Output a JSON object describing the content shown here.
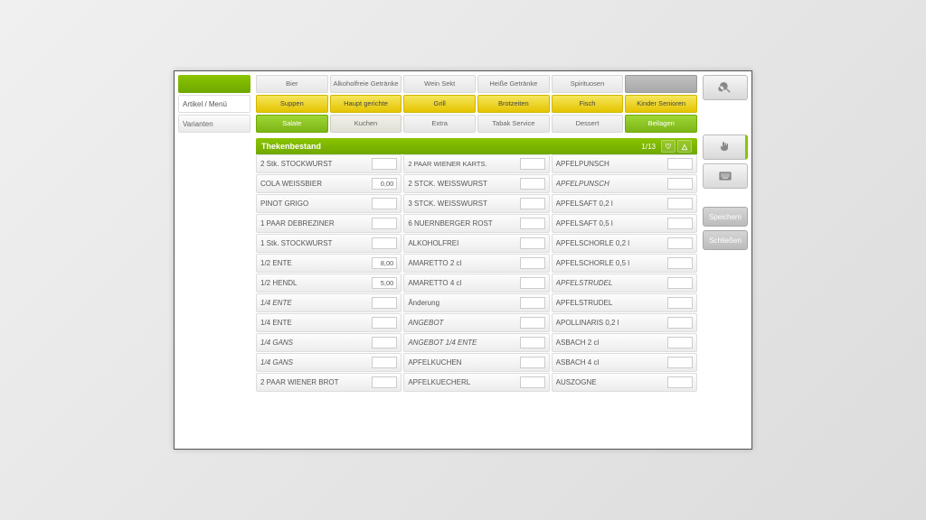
{
  "sidebar": {
    "items": [
      {
        "label": "Artikel / Menü"
      },
      {
        "label": "Varianten"
      }
    ]
  },
  "tabs": {
    "row1": [
      {
        "label": "Bier",
        "style": "gray"
      },
      {
        "label": "Alkoholfreie Getränke",
        "style": "gray"
      },
      {
        "label": "Wein Sekt",
        "style": "gray"
      },
      {
        "label": "Heiße Getränke",
        "style": "gray"
      },
      {
        "label": "Spirituosen",
        "style": "gray"
      },
      {
        "label": "",
        "style": "darkgray"
      }
    ],
    "row2": [
      {
        "label": "Suppen",
        "style": "yellow"
      },
      {
        "label": "Haupt gerichte",
        "style": "yellow"
      },
      {
        "label": "Grill",
        "style": "yellow"
      },
      {
        "label": "Brotzeiten",
        "style": "yellow"
      },
      {
        "label": "Fisch",
        "style": "yellow"
      },
      {
        "label": "Kinder Senioren",
        "style": "yellow"
      }
    ],
    "row3": [
      {
        "label": "Salate",
        "style": "green"
      },
      {
        "label": "Kuchen",
        "style": "lightgray-special"
      },
      {
        "label": "Extra",
        "style": "gray"
      },
      {
        "label": "Tabak Service",
        "style": "gray"
      },
      {
        "label": "Dessert",
        "style": "gray"
      },
      {
        "label": "Beilagen",
        "style": "green"
      }
    ]
  },
  "list": {
    "title": "Thekenbestand",
    "page": "1/13",
    "columns": [
      [
        {
          "label": "2 Stk. STOCKWURST",
          "qty": ""
        },
        {
          "label": "COLA WEISSBIER",
          "qty": "0,00"
        },
        {
          "label": "PINOT GRIGO",
          "qty": ""
        },
        {
          "label": "1 PAAR DEBREZINER",
          "qty": ""
        },
        {
          "label": "1 Stk. STOCKWURST",
          "qty": ""
        },
        {
          "label": "1/2 ENTE",
          "qty": "8,00"
        },
        {
          "label": "1/2 HENDL",
          "qty": "5,00"
        },
        {
          "label": "1/4 ENTE",
          "qty": "",
          "italic": true
        },
        {
          "label": "1/4 ENTE",
          "qty": ""
        },
        {
          "label": "1/4 GANS",
          "qty": "",
          "italic": true
        },
        {
          "label": "1/4 GANS",
          "qty": "",
          "italic": true
        },
        {
          "label": "2 PAAR WIENER BROT",
          "qty": ""
        }
      ],
      [
        {
          "label": "2 PAAR WIENER KARTS.",
          "qty": "",
          "twoline": true
        },
        {
          "label": "2 STCK. WEISSWURST",
          "qty": ""
        },
        {
          "label": "3 STCK. WEISSWURST",
          "qty": ""
        },
        {
          "label": "6 NUERNBERGER ROST",
          "qty": ""
        },
        {
          "label": "ALKOHOLFREI",
          "qty": ""
        },
        {
          "label": "AMARETTO 2 cl",
          "qty": ""
        },
        {
          "label": "AMARETTO 4 cl",
          "qty": ""
        },
        {
          "label": "Änderung",
          "qty": ""
        },
        {
          "label": "ANGEBOT",
          "qty": "",
          "italic": true
        },
        {
          "label": "ANGEBOT 1/4 ENTE",
          "qty": "",
          "italic": true
        },
        {
          "label": "APFELKUCHEN",
          "qty": ""
        },
        {
          "label": "APFELKUECHERL",
          "qty": ""
        }
      ],
      [
        {
          "label": "APFELPUNSCH",
          "qty": ""
        },
        {
          "label": "APFELPUNSCH",
          "qty": "",
          "italic": true
        },
        {
          "label": "APFELSAFT 0,2 l",
          "qty": ""
        },
        {
          "label": "APFELSAFT 0,5 l",
          "qty": ""
        },
        {
          "label": "APFELSCHORLE 0,2 l",
          "qty": ""
        },
        {
          "label": "APFELSCHORLE 0,5 l",
          "qty": ""
        },
        {
          "label": "APFELSTRUDEL",
          "qty": "",
          "italic": true
        },
        {
          "label": "APFELSTRUDEL",
          "qty": ""
        },
        {
          "label": "APOLLINARIS 0,2 l",
          "qty": ""
        },
        {
          "label": "ASBACH 2 cl",
          "qty": ""
        },
        {
          "label": "ASBACH 4 cl",
          "qty": ""
        },
        {
          "label": "AUSZOGNE",
          "qty": ""
        }
      ]
    ]
  },
  "actions": {
    "save": "Speichern",
    "close": "Schließen"
  }
}
